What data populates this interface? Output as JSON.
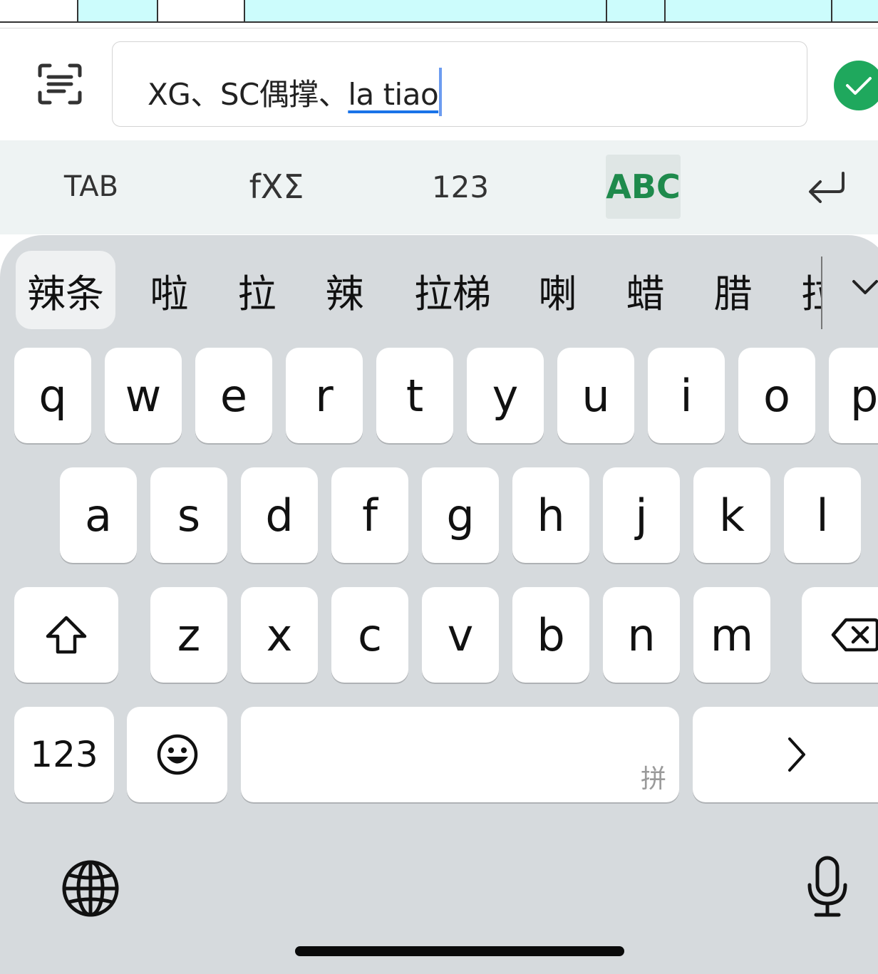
{
  "formula_bar": {
    "scan_icon": "scan-text-icon",
    "text_committed": "XG、SC偶撑、",
    "text_composing": "la tiao",
    "confirm_icon": "check-icon",
    "confirm_color": "#1fa85d"
  },
  "function_toolbar": {
    "tab_label": "TAB",
    "formula_label": "fXΣ",
    "numbers_label": "123",
    "letters_label": "ABC",
    "enter_icon": "return-icon",
    "active_color": "#1e8a4c"
  },
  "candidates": [
    "辣条",
    "啦",
    "拉",
    "辣",
    "拉梯",
    "喇",
    "蜡",
    "腊",
    "拉"
  ],
  "candidates_expand_icon": "chevron-down-icon",
  "keyboard": {
    "row1": [
      "q",
      "w",
      "e",
      "r",
      "t",
      "y",
      "u",
      "i",
      "o",
      "p"
    ],
    "row2": [
      "a",
      "s",
      "d",
      "f",
      "g",
      "h",
      "j",
      "k",
      "l"
    ],
    "row3": [
      "z",
      "x",
      "c",
      "v",
      "b",
      "n",
      "m"
    ],
    "shift_icon": "shift-icon",
    "delete_icon": "backspace-icon",
    "numbers_key": "123",
    "emoji_icon": "emoji-icon",
    "space_hint": "拼",
    "next_icon": "chevron-right-icon",
    "globe_icon": "globe-icon",
    "mic_icon": "microphone-icon"
  }
}
